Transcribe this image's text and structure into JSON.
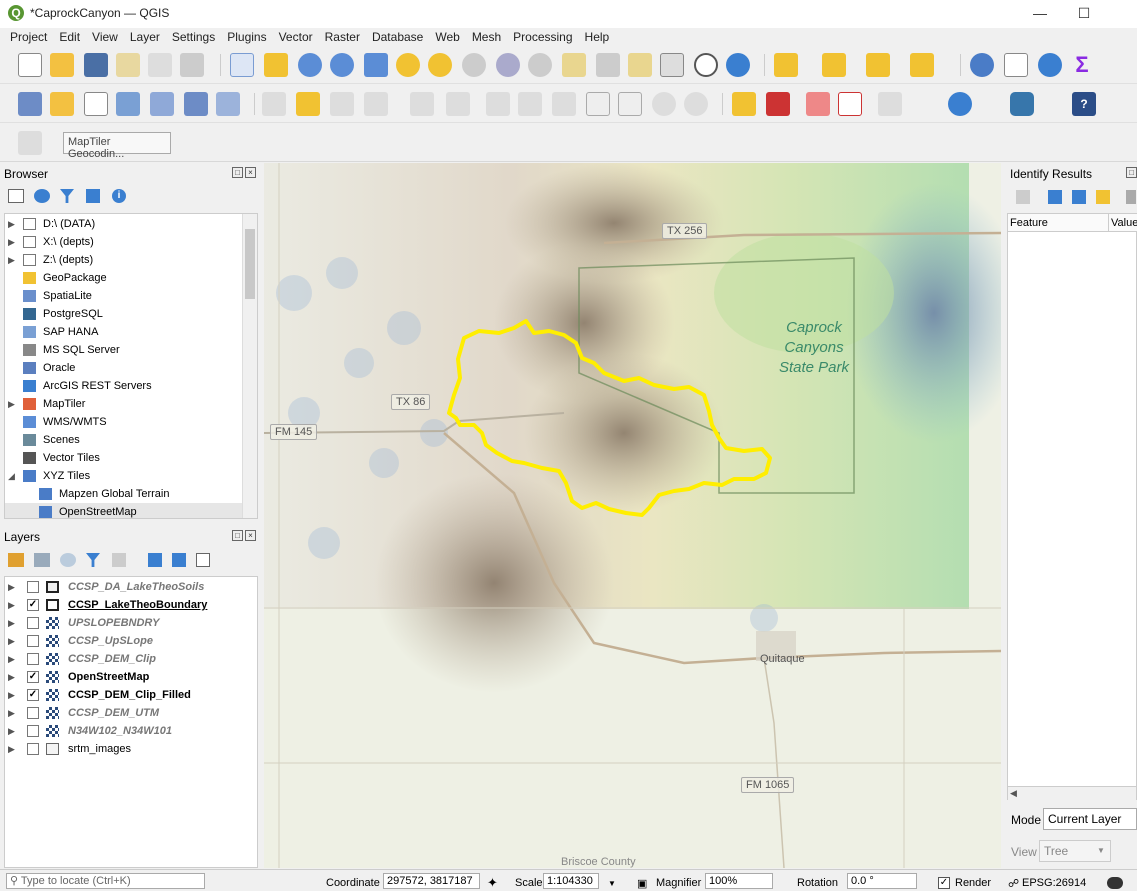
{
  "window": {
    "title": "*CaprockCanyon — QGIS",
    "app_icon_letter": "Q",
    "minimize": "—",
    "maximize": "☐"
  },
  "menu": [
    "Project",
    "Edit",
    "View",
    "Layer",
    "Settings",
    "Plugins",
    "Vector",
    "Raster",
    "Database",
    "Web",
    "Mesh",
    "Processing",
    "Help"
  ],
  "toolbar3": {
    "geocoder_placeholder": "MapTiler Geocodin..."
  },
  "browser": {
    "title": "Browser",
    "items": [
      {
        "label": "D:\\ (DATA)",
        "icon": "folder-icon",
        "expandable": true
      },
      {
        "label": "X:\\ (depts)",
        "icon": "folder-icon",
        "expandable": true
      },
      {
        "label": "Z:\\ (depts)",
        "icon": "folder-icon",
        "expandable": true
      },
      {
        "label": "GeoPackage",
        "icon": "geopackage-icon",
        "expandable": false
      },
      {
        "label": "SpatiaLite",
        "icon": "spatialite-icon",
        "expandable": false
      },
      {
        "label": "PostgreSQL",
        "icon": "postgresql-icon",
        "expandable": false
      },
      {
        "label": "SAP HANA",
        "icon": "sap-hana-icon",
        "expandable": false
      },
      {
        "label": "MS SQL Server",
        "icon": "mssql-icon",
        "expandable": false
      },
      {
        "label": "Oracle",
        "icon": "oracle-icon",
        "expandable": false
      },
      {
        "label": "ArcGIS REST Servers",
        "icon": "arcgis-icon",
        "expandable": false
      },
      {
        "label": "MapTiler",
        "icon": "maptiler-icon",
        "expandable": true
      },
      {
        "label": "WMS/WMTS",
        "icon": "wms-icon",
        "expandable": false
      },
      {
        "label": "Scenes",
        "icon": "scenes-icon",
        "expandable": false
      },
      {
        "label": "Vector Tiles",
        "icon": "vector-tiles-icon",
        "expandable": false
      },
      {
        "label": "XYZ Tiles",
        "icon": "xyz-tiles-icon",
        "expandable": true
      },
      {
        "label": "Mapzen Global Terrain",
        "icon": "xyz-tiles-icon",
        "expandable": false
      },
      {
        "label": "OpenStreetMap",
        "icon": "xyz-tiles-icon",
        "expandable": false
      }
    ]
  },
  "layers": {
    "title": "Layers",
    "items": [
      {
        "label": "CCSP_DA_LakeTheoSoils",
        "checked": false,
        "icon": "polygon-layer-icon",
        "style": "italic"
      },
      {
        "label": "CCSP_LakeTheoBoundary",
        "checked": true,
        "icon": "polygon-layer-icon",
        "style": "bold-underline"
      },
      {
        "label": "UPSLOPEBNDRY",
        "checked": false,
        "icon": "raster-layer-icon",
        "style": "italic"
      },
      {
        "label": "CCSP_UpSLope",
        "checked": false,
        "icon": "raster-layer-icon",
        "style": "italic"
      },
      {
        "label": "CCSP_DEM_Clip",
        "checked": false,
        "icon": "raster-layer-icon",
        "style": "italic"
      },
      {
        "label": "OpenStreetMap",
        "checked": true,
        "icon": "raster-layer-icon",
        "style": "bold"
      },
      {
        "label": "CCSP_DEM_Clip_Filled",
        "checked": true,
        "icon": "raster-layer-icon",
        "style": "bold"
      },
      {
        "label": "CCSP_DEM_UTM",
        "checked": false,
        "icon": "raster-layer-icon",
        "style": "italic"
      },
      {
        "label": "N34W102_N34W101",
        "checked": false,
        "icon": "raster-layer-icon",
        "style": "italic"
      },
      {
        "label": "srtm_images",
        "checked": false,
        "icon": "group-icon",
        "style": "normal"
      }
    ]
  },
  "map": {
    "labels": {
      "tx256": "TX 256",
      "tx86": "TX 86",
      "fm145": "FM 145",
      "fm1065": "FM 1065",
      "quitaque": "Quitaque",
      "park_line1": "Caprock",
      "park_line2": "Canyons",
      "park_line3": "State Park",
      "briscoe": "Briscoe County"
    }
  },
  "identify": {
    "title": "Identify Results",
    "col_feature": "Feature",
    "col_value": "Value",
    "mode_label": "Mode",
    "mode_value": "Current Layer",
    "view_label": "View",
    "view_value": "Tree"
  },
  "status": {
    "locate_placeholder": "Type to locate (Ctrl+K)",
    "coordinate_label": "Coordinate",
    "coordinate_value": "297572, 3817187",
    "scale_label": "Scale",
    "scale_value": "1:104330",
    "magnifier_label": "Magnifier",
    "magnifier_value": "100%",
    "rotation_label": "Rotation",
    "rotation_value": "0.0 °",
    "render_label": "Render",
    "render_checked": true,
    "crs": "EPSG:26914"
  },
  "colors": {
    "boundary": "#ffee00",
    "qgis_green": "#589632"
  }
}
